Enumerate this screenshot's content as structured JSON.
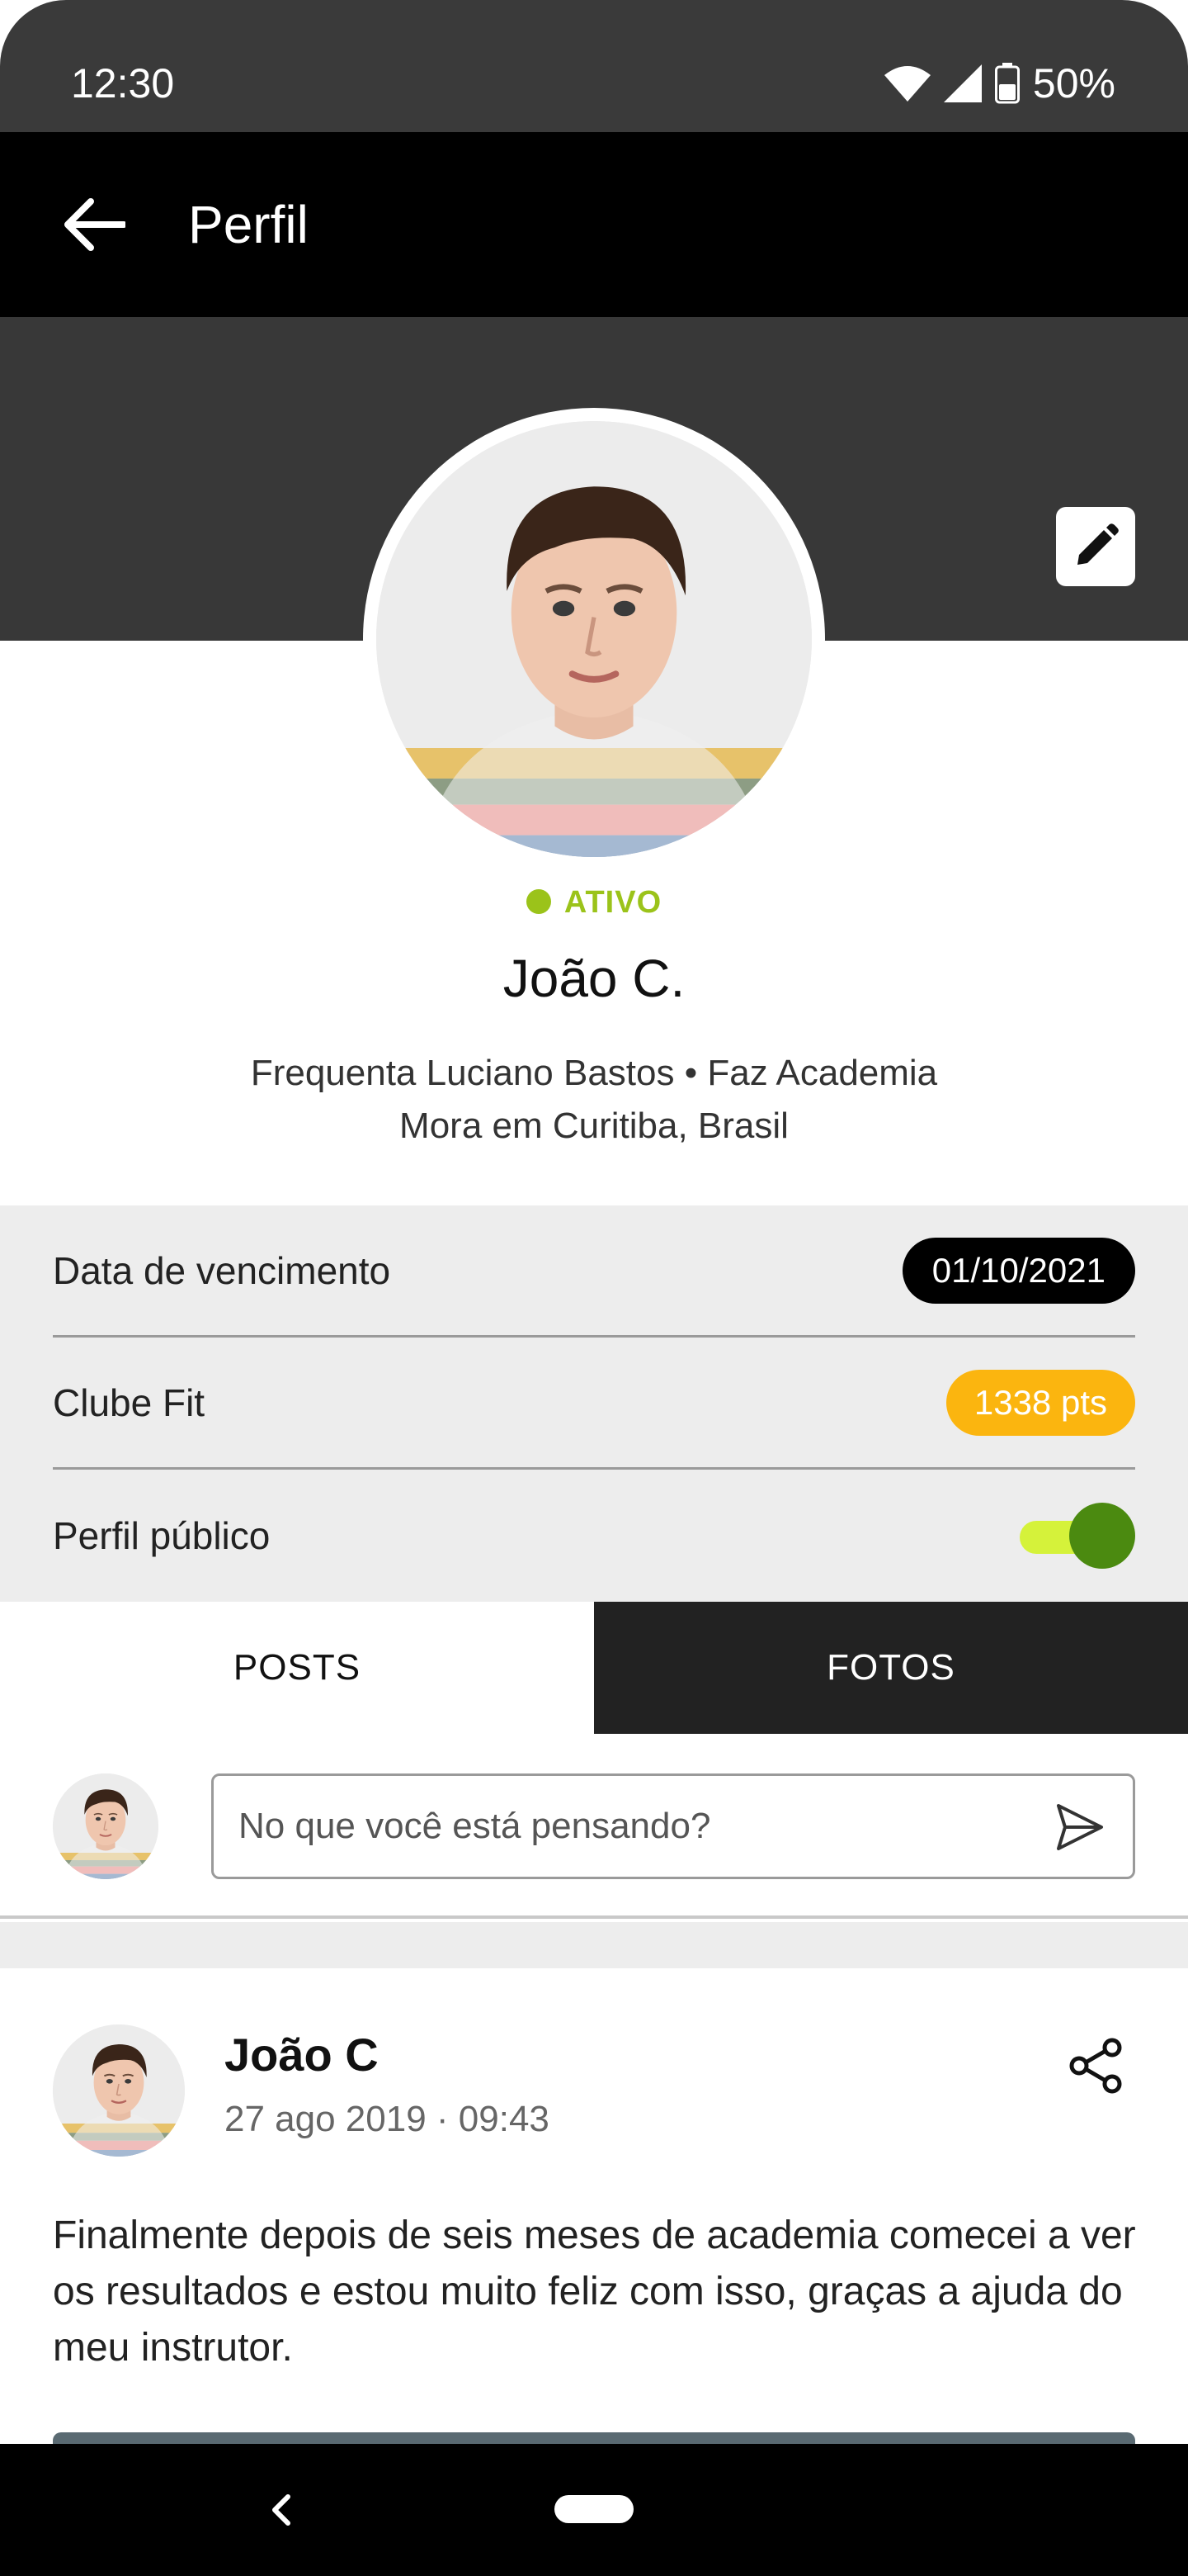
{
  "status_bar": {
    "time": "12:30",
    "battery": "50%"
  },
  "app_bar": {
    "title": "Perfil"
  },
  "profile": {
    "status": "ATIVO",
    "name": "João C.",
    "info_line1": "Frequenta Luciano Bastos • Faz Academia",
    "info_line2": "Mora em Curitiba, Brasil"
  },
  "details": {
    "due_date_label": "Data de vencimento",
    "due_date_value": "01/10/2021",
    "club_label": "Clube Fit",
    "club_points": "1338 pts",
    "public_label": "Perfil público",
    "public_enabled": true
  },
  "tabs": {
    "posts": "POSTS",
    "photos": "FOTOS"
  },
  "composer": {
    "placeholder": "No que você está pensando?"
  },
  "post": {
    "author": "João C",
    "timestamp": "27 ago 2019 · 09:43",
    "text": "Finalmente depois de seis meses de academia comecei a ver os resultados e estou muito feliz com isso, graças a ajuda do meu instrutor."
  },
  "colors": {
    "status_active": "#9bc31a",
    "points_pill": "#fbb50f",
    "toggle_track": "#d5f23a",
    "toggle_knob": "#4b8a10"
  },
  "icons": [
    "back-arrow-icon",
    "pencil-icon",
    "send-icon",
    "share-icon",
    "wifi-icon",
    "signal-icon",
    "battery-icon"
  ]
}
